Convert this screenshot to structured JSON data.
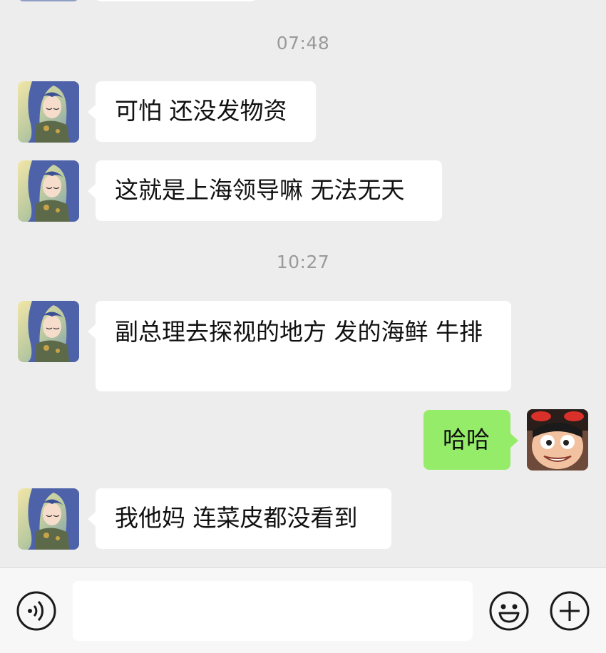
{
  "messages": [
    {
      "kind": "time",
      "text": "07:48"
    },
    {
      "kind": "in",
      "text": "可怕 还没发物资"
    },
    {
      "kind": "in",
      "text": "这就是上海领导嘛 无法无天"
    },
    {
      "kind": "time",
      "text": "10:27"
    },
    {
      "kind": "in",
      "text": "副总理去探视的地方 发的海鲜 牛排"
    },
    {
      "kind": "out",
      "text": "哈哈"
    },
    {
      "kind": "in",
      "text": "我他妈 连菜皮都没看到"
    }
  ],
  "input": {
    "value": "",
    "placeholder": ""
  },
  "toolbar": {
    "voice_icon": "voice-icon",
    "emoji_icon": "emoji-icon",
    "plus_icon": "plus-icon"
  },
  "colors": {
    "background": "#ededed",
    "incoming_bubble": "#ffffff",
    "outgoing_bubble": "#95ec69",
    "timestamp": "#9a9a9a",
    "toolbar": "#f7f7f7"
  }
}
